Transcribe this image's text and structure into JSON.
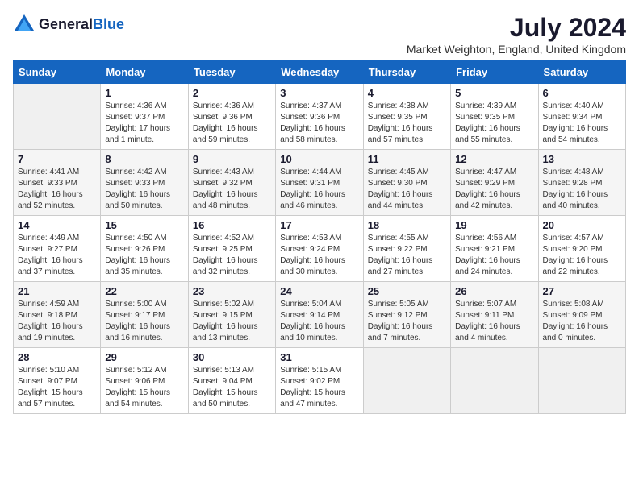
{
  "header": {
    "logo_general": "General",
    "logo_blue": "Blue",
    "title": "July 2024",
    "subtitle": "Market Weighton, England, United Kingdom"
  },
  "days_of_week": [
    "Sunday",
    "Monday",
    "Tuesday",
    "Wednesday",
    "Thursday",
    "Friday",
    "Saturday"
  ],
  "weeks": [
    [
      {
        "day": "",
        "info": ""
      },
      {
        "day": "1",
        "info": "Sunrise: 4:36 AM\nSunset: 9:37 PM\nDaylight: 17 hours\nand 1 minute."
      },
      {
        "day": "2",
        "info": "Sunrise: 4:36 AM\nSunset: 9:36 PM\nDaylight: 16 hours\nand 59 minutes."
      },
      {
        "day": "3",
        "info": "Sunrise: 4:37 AM\nSunset: 9:36 PM\nDaylight: 16 hours\nand 58 minutes."
      },
      {
        "day": "4",
        "info": "Sunrise: 4:38 AM\nSunset: 9:35 PM\nDaylight: 16 hours\nand 57 minutes."
      },
      {
        "day": "5",
        "info": "Sunrise: 4:39 AM\nSunset: 9:35 PM\nDaylight: 16 hours\nand 55 minutes."
      },
      {
        "day": "6",
        "info": "Sunrise: 4:40 AM\nSunset: 9:34 PM\nDaylight: 16 hours\nand 54 minutes."
      }
    ],
    [
      {
        "day": "7",
        "info": "Sunrise: 4:41 AM\nSunset: 9:33 PM\nDaylight: 16 hours\nand 52 minutes."
      },
      {
        "day": "8",
        "info": "Sunrise: 4:42 AM\nSunset: 9:33 PM\nDaylight: 16 hours\nand 50 minutes."
      },
      {
        "day": "9",
        "info": "Sunrise: 4:43 AM\nSunset: 9:32 PM\nDaylight: 16 hours\nand 48 minutes."
      },
      {
        "day": "10",
        "info": "Sunrise: 4:44 AM\nSunset: 9:31 PM\nDaylight: 16 hours\nand 46 minutes."
      },
      {
        "day": "11",
        "info": "Sunrise: 4:45 AM\nSunset: 9:30 PM\nDaylight: 16 hours\nand 44 minutes."
      },
      {
        "day": "12",
        "info": "Sunrise: 4:47 AM\nSunset: 9:29 PM\nDaylight: 16 hours\nand 42 minutes."
      },
      {
        "day": "13",
        "info": "Sunrise: 4:48 AM\nSunset: 9:28 PM\nDaylight: 16 hours\nand 40 minutes."
      }
    ],
    [
      {
        "day": "14",
        "info": "Sunrise: 4:49 AM\nSunset: 9:27 PM\nDaylight: 16 hours\nand 37 minutes."
      },
      {
        "day": "15",
        "info": "Sunrise: 4:50 AM\nSunset: 9:26 PM\nDaylight: 16 hours\nand 35 minutes."
      },
      {
        "day": "16",
        "info": "Sunrise: 4:52 AM\nSunset: 9:25 PM\nDaylight: 16 hours\nand 32 minutes."
      },
      {
        "day": "17",
        "info": "Sunrise: 4:53 AM\nSunset: 9:24 PM\nDaylight: 16 hours\nand 30 minutes."
      },
      {
        "day": "18",
        "info": "Sunrise: 4:55 AM\nSunset: 9:22 PM\nDaylight: 16 hours\nand 27 minutes."
      },
      {
        "day": "19",
        "info": "Sunrise: 4:56 AM\nSunset: 9:21 PM\nDaylight: 16 hours\nand 24 minutes."
      },
      {
        "day": "20",
        "info": "Sunrise: 4:57 AM\nSunset: 9:20 PM\nDaylight: 16 hours\nand 22 minutes."
      }
    ],
    [
      {
        "day": "21",
        "info": "Sunrise: 4:59 AM\nSunset: 9:18 PM\nDaylight: 16 hours\nand 19 minutes."
      },
      {
        "day": "22",
        "info": "Sunrise: 5:00 AM\nSunset: 9:17 PM\nDaylight: 16 hours\nand 16 minutes."
      },
      {
        "day": "23",
        "info": "Sunrise: 5:02 AM\nSunset: 9:15 PM\nDaylight: 16 hours\nand 13 minutes."
      },
      {
        "day": "24",
        "info": "Sunrise: 5:04 AM\nSunset: 9:14 PM\nDaylight: 16 hours\nand 10 minutes."
      },
      {
        "day": "25",
        "info": "Sunrise: 5:05 AM\nSunset: 9:12 PM\nDaylight: 16 hours\nand 7 minutes."
      },
      {
        "day": "26",
        "info": "Sunrise: 5:07 AM\nSunset: 9:11 PM\nDaylight: 16 hours\nand 4 minutes."
      },
      {
        "day": "27",
        "info": "Sunrise: 5:08 AM\nSunset: 9:09 PM\nDaylight: 16 hours\nand 0 minutes."
      }
    ],
    [
      {
        "day": "28",
        "info": "Sunrise: 5:10 AM\nSunset: 9:07 PM\nDaylight: 15 hours\nand 57 minutes."
      },
      {
        "day": "29",
        "info": "Sunrise: 5:12 AM\nSunset: 9:06 PM\nDaylight: 15 hours\nand 54 minutes."
      },
      {
        "day": "30",
        "info": "Sunrise: 5:13 AM\nSunset: 9:04 PM\nDaylight: 15 hours\nand 50 minutes."
      },
      {
        "day": "31",
        "info": "Sunrise: 5:15 AM\nSunset: 9:02 PM\nDaylight: 15 hours\nand 47 minutes."
      },
      {
        "day": "",
        "info": ""
      },
      {
        "day": "",
        "info": ""
      },
      {
        "day": "",
        "info": ""
      }
    ]
  ]
}
